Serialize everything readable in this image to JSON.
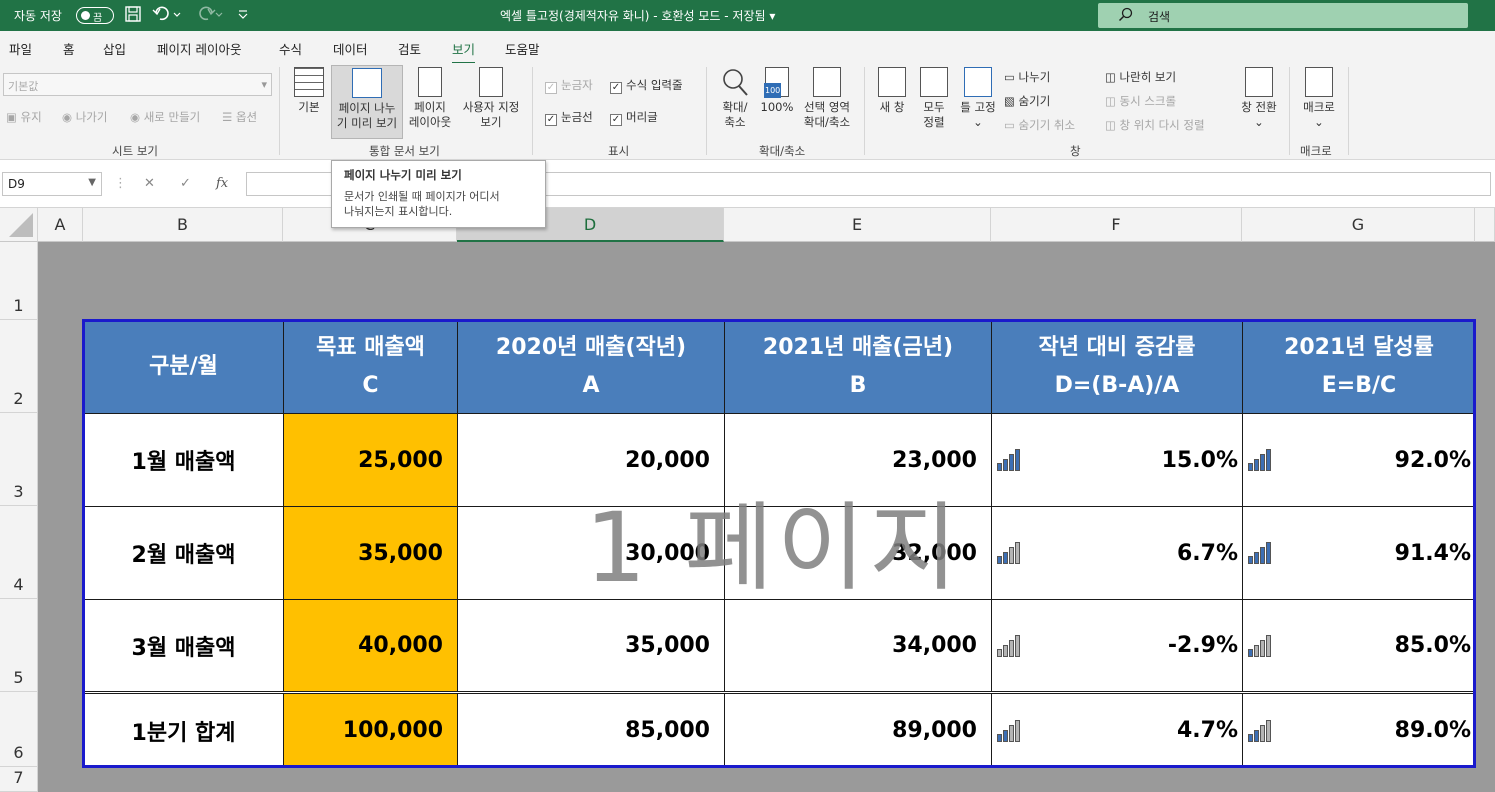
{
  "titlebar": {
    "autosave_label": "자동 저장",
    "autosave_state": "끔",
    "doc_title": "엑셀 틀고정(경제적자유 화니)  -  호환성 모드  -  저장됨 ▾",
    "search_placeholder": "검색",
    "accent_color": "#217346"
  },
  "menu": {
    "tabs": [
      "파일",
      "홈",
      "삽입",
      "페이지 레이아웃",
      "수식",
      "데이터",
      "검토",
      "보기",
      "도움말"
    ],
    "active": "보기"
  },
  "ribbon": {
    "sheet_view": {
      "combo_value": "기본값",
      "keep": "유지",
      "exit": "나가기",
      "new": "새로 만들기",
      "options": "옵션",
      "label": "시트 보기"
    },
    "workbook_views": {
      "normal": "기본",
      "page_break_l1": "페이지 나누",
      "page_break_l2": "기 미리 보기",
      "page_layout_l1": "페이지",
      "page_layout_l2": "레이아웃",
      "custom_l1": "사용자 지정",
      "custom_l2": "보기",
      "label": "통합 문서 보기"
    },
    "show": {
      "ruler": "눈금자",
      "formula_bar": "수식 입력줄",
      "gridlines": "눈금선",
      "headings": "머리글",
      "label": "표시"
    },
    "zoom": {
      "zoom_l1": "확대/",
      "zoom_l2": "축소",
      "hundred": "100%",
      "hundred_icon_text": "100",
      "selection_l1": "선택 영역",
      "selection_l2": "확대/축소",
      "label": "확대/축소"
    },
    "window": {
      "new_window": "새 창",
      "arrange_l1": "모두",
      "arrange_l2": "정렬",
      "freeze": "틀 고정",
      "split": "나누기",
      "hide": "숨기기",
      "unhide": "숨기기 취소",
      "side_by_side": "나란히 보기",
      "sync_scroll": "동시 스크롤",
      "reset_pos": "창 위치 다시 정렬",
      "switch_windows": "창 전환",
      "label": "창"
    },
    "macros": {
      "macros": "매크로",
      "label": "매크로"
    }
  },
  "formula_bar": {
    "name_box": "D9",
    "fx": "fx",
    "cancel": "✕",
    "enter": "✓"
  },
  "tooltip": {
    "title": "페이지 나누기 미리 보기",
    "body_l1": "문서가 인쇄될 때 페이지가 어디서",
    "body_l2": "나눠지는지 표시합니다."
  },
  "columns": [
    "A",
    "B",
    "C",
    "D",
    "E",
    "F",
    "G"
  ],
  "rows": [
    "1",
    "2",
    "3",
    "4",
    "5",
    "6",
    "7"
  ],
  "watermark": "1 페이지",
  "table": {
    "header": {
      "col_b": "구분/월",
      "col_c_l1": "목표 매출액",
      "col_c_l2": "C",
      "col_d_l1": "2020년 매출(작년)",
      "col_d_l2": "A",
      "col_e_l1": "2021년 매출(금년)",
      "col_e_l2": "B",
      "col_f_l1": "작년 대비 증감률",
      "col_f_l2": "D=(B-A)/A",
      "col_g_l1": "2021년 달성률",
      "col_g_l2": "E=B/C"
    },
    "rows": [
      {
        "label": "1월 매출액",
        "target": "25,000",
        "y2020": "20,000",
        "y2021": "23,000",
        "growth": "15.0%",
        "growth_bars": 4,
        "rate": "92.0%",
        "rate_bars": 4
      },
      {
        "label": "2월 매출액",
        "target": "35,000",
        "y2020": "30,000",
        "y2021": "32,000",
        "growth": "6.7%",
        "growth_bars": 2,
        "rate": "91.4%",
        "rate_bars": 4
      },
      {
        "label": "3월 매출액",
        "target": "40,000",
        "y2020": "35,000",
        "y2021": "34,000",
        "growth": "-2.9%",
        "growth_bars": 0,
        "rate": "85.0%",
        "rate_bars": 1
      },
      {
        "label": "1분기 합계",
        "target": "100,000",
        "y2020": "85,000",
        "y2021": "89,000",
        "growth": "4.7%",
        "growth_bars": 2,
        "rate": "89.0%",
        "rate_bars": 2
      }
    ],
    "colors": {
      "header_bg": "#4a7ebb",
      "target_bg": "#ffc000",
      "bar_on": "#3d6fb4",
      "bar_off": "#b5b5b5",
      "outline": "#1a1acc"
    }
  }
}
